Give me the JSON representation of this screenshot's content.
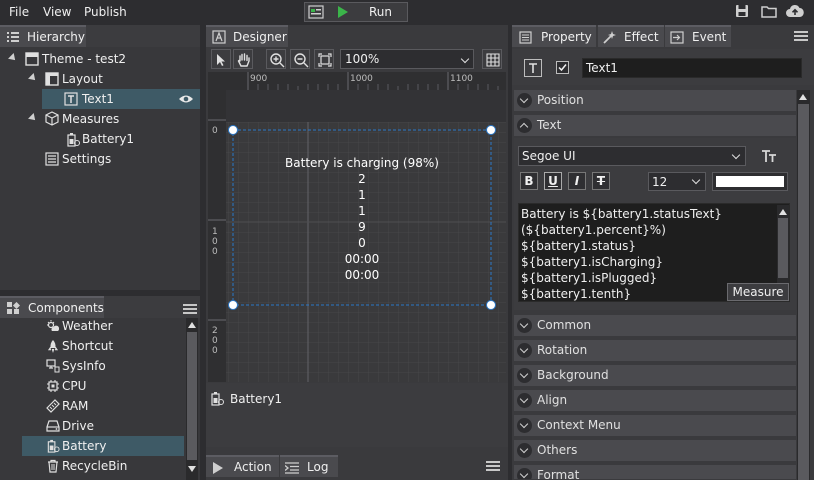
{
  "menubar": {
    "file": "File",
    "view": "View",
    "publish": "Publish",
    "run": "Run"
  },
  "hierarchy": {
    "tab": "Hierarchy",
    "items": [
      {
        "label": "Theme - test2"
      },
      {
        "label": "Layout"
      },
      {
        "label": "Text1"
      },
      {
        "label": "Measures"
      },
      {
        "label": "Battery1"
      },
      {
        "label": "Settings"
      }
    ]
  },
  "components": {
    "tab": "Components",
    "items": [
      {
        "label": "Weather",
        "icon": "weather-icon"
      },
      {
        "label": "Shortcut",
        "icon": "rocket-icon"
      },
      {
        "label": "SysInfo",
        "icon": "sysinfo-icon"
      },
      {
        "label": "CPU",
        "icon": "cpu-icon"
      },
      {
        "label": "RAM",
        "icon": "ram-icon"
      },
      {
        "label": "Drive",
        "icon": "drive-icon"
      },
      {
        "label": "Battery",
        "icon": "battery-icon"
      },
      {
        "label": "RecycleBin",
        "icon": "recyclebin-icon"
      }
    ]
  },
  "designer": {
    "tab": "Designer",
    "zoom": "100%",
    "ruler_x": [
      "900",
      "1000",
      "1100"
    ],
    "ruler_y_0": "0",
    "ruler_y_100": [
      "1",
      "0",
      "0"
    ],
    "ruler_y_200": [
      "2",
      "0",
      "0"
    ],
    "text_lines": [
      "Battery is charging (98%)",
      "2",
      "1",
      "1",
      "9",
      "0",
      "00:00",
      "00:00"
    ],
    "measure_item": "Battery1",
    "bottom_tabs": {
      "action": "Action",
      "log": "Log"
    }
  },
  "property": {
    "tabs": {
      "property": "Property",
      "effect": "Effect",
      "event": "Event"
    },
    "name_value": "Text1",
    "sections_top": [
      "Position",
      "Text"
    ],
    "font": "Segoe UI",
    "font_size": "12",
    "format_buttons": {
      "bold": "B",
      "underline": "U",
      "italic": "I",
      "strike": "T"
    },
    "text_lines": [
      "Battery is ${battery1.statusText}",
      "(${battery1.percent}%)",
      "${battery1.status}",
      "${battery1.isCharging}",
      "${battery1.isPlugged}",
      "${battery1.tenth}"
    ],
    "measure_button": "Measure",
    "sections_bottom": [
      "Common",
      "Rotation",
      "Background",
      "Align",
      "Context Menu",
      "Others",
      "Format"
    ]
  },
  "colors": {
    "accent_selected": "#3e5a66",
    "handle_border": "#2b78c8",
    "play_green": "#3bb54a",
    "background": "#2d2d30"
  }
}
